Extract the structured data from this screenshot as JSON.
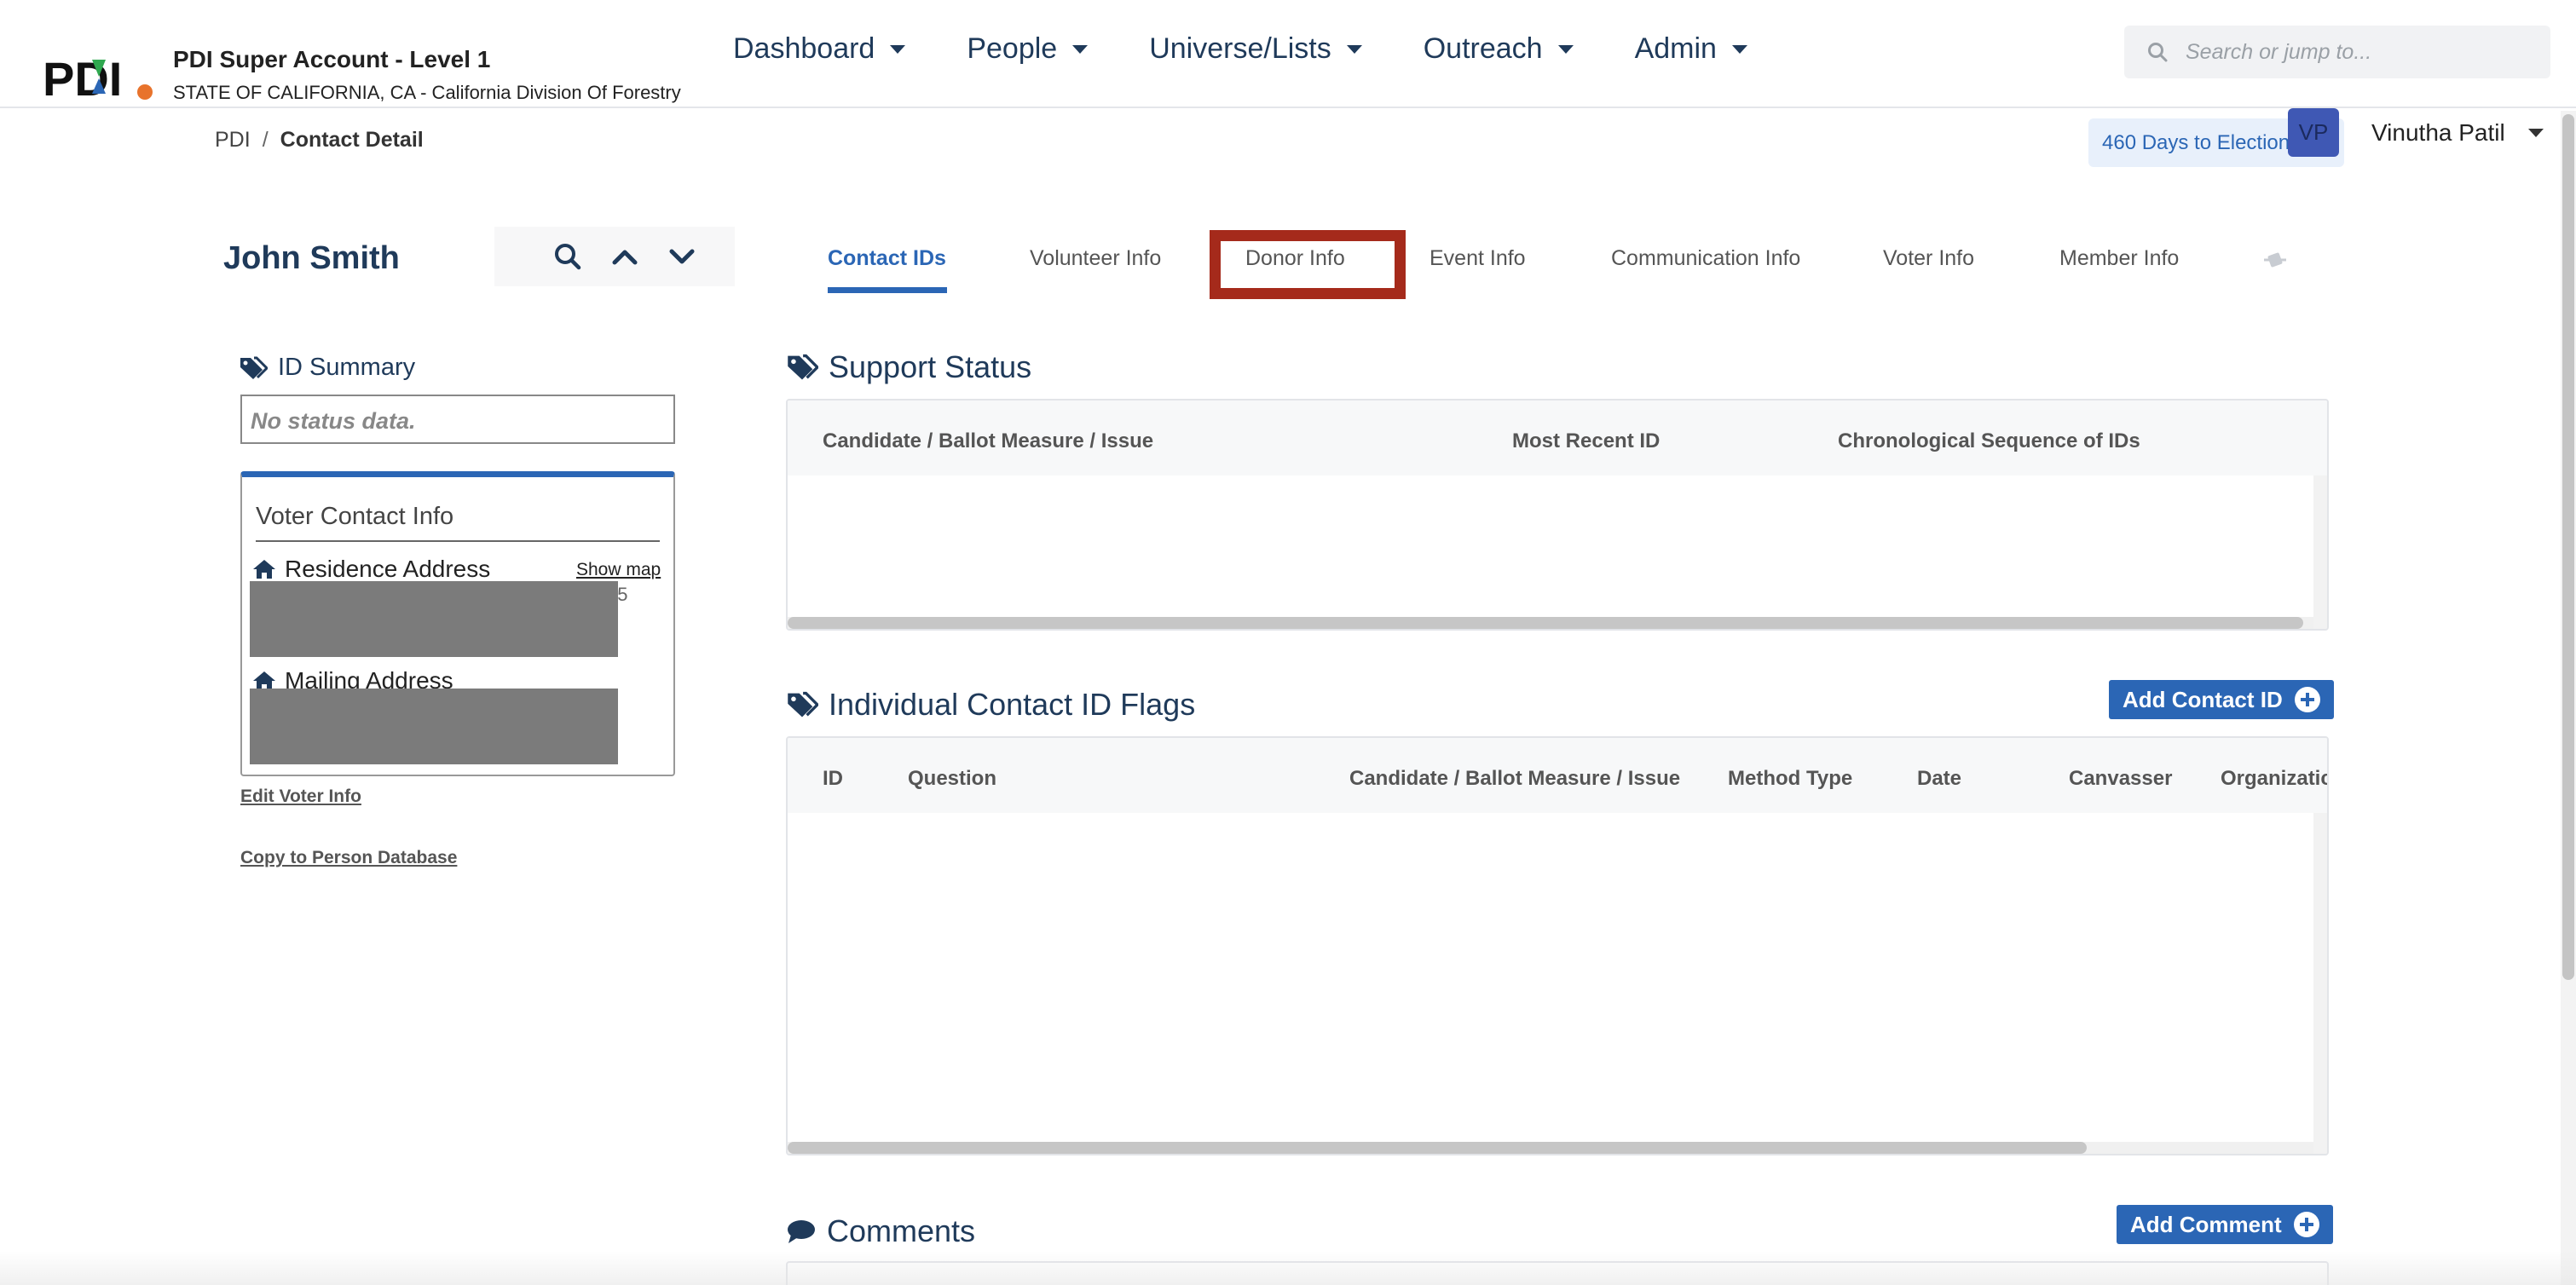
{
  "app": {
    "account_name": "PDI Super Account - Level 1",
    "account_sub": "STATE OF CALIFORNIA, CA - California Division Of Forestry"
  },
  "nav": {
    "items": [
      {
        "label": "Dashboard"
      },
      {
        "label": "People"
      },
      {
        "label": "Universe/Lists"
      },
      {
        "label": "Outreach"
      },
      {
        "label": "Admin"
      }
    ]
  },
  "search": {
    "placeholder": "Search or jump to..."
  },
  "breadcrumb": {
    "root": "PDI",
    "sep": "/",
    "current": "Contact Detail"
  },
  "election_badge": "460 Days to Election Day",
  "user": {
    "initials": "VP",
    "name": "Vinutha Patil"
  },
  "contact": {
    "name": "John Smith"
  },
  "tabs": [
    {
      "label": "Contact IDs",
      "active": true
    },
    {
      "label": "Volunteer Info"
    },
    {
      "label": "Donor Info"
    },
    {
      "label": "Event Info"
    },
    {
      "label": "Communication Info"
    },
    {
      "label": "Voter Info"
    },
    {
      "label": "Member Info"
    }
  ],
  "id_summary": {
    "title": "ID Summary",
    "empty_text": "No status data."
  },
  "voter_contact": {
    "title": "Voter Contact Info",
    "residence_label": "Residence Address",
    "show_map": "Show map",
    "residence_fragment": "05",
    "mailing_label": "Mailing Address",
    "edit_link": "Edit Voter Info",
    "copy_link": "Copy to Person Database"
  },
  "support_status": {
    "title": "Support Status",
    "columns": [
      "Candidate / Ballot Measure / Issue",
      "Most Recent ID",
      "Chronological Sequence of IDs"
    ]
  },
  "contact_flags": {
    "title": "Individual Contact ID Flags",
    "add_button": "Add Contact ID",
    "columns": [
      "ID",
      "Question",
      "Candidate / Ballot Measure / Issue",
      "Method Type",
      "Date",
      "Canvasser",
      "Organizatic"
    ]
  },
  "comments": {
    "title": "Comments",
    "add_button": "Add Comment"
  },
  "colors": {
    "accent": "#2b66b5",
    "highlight": "#a52a1b",
    "heading": "#1f3a5a"
  }
}
